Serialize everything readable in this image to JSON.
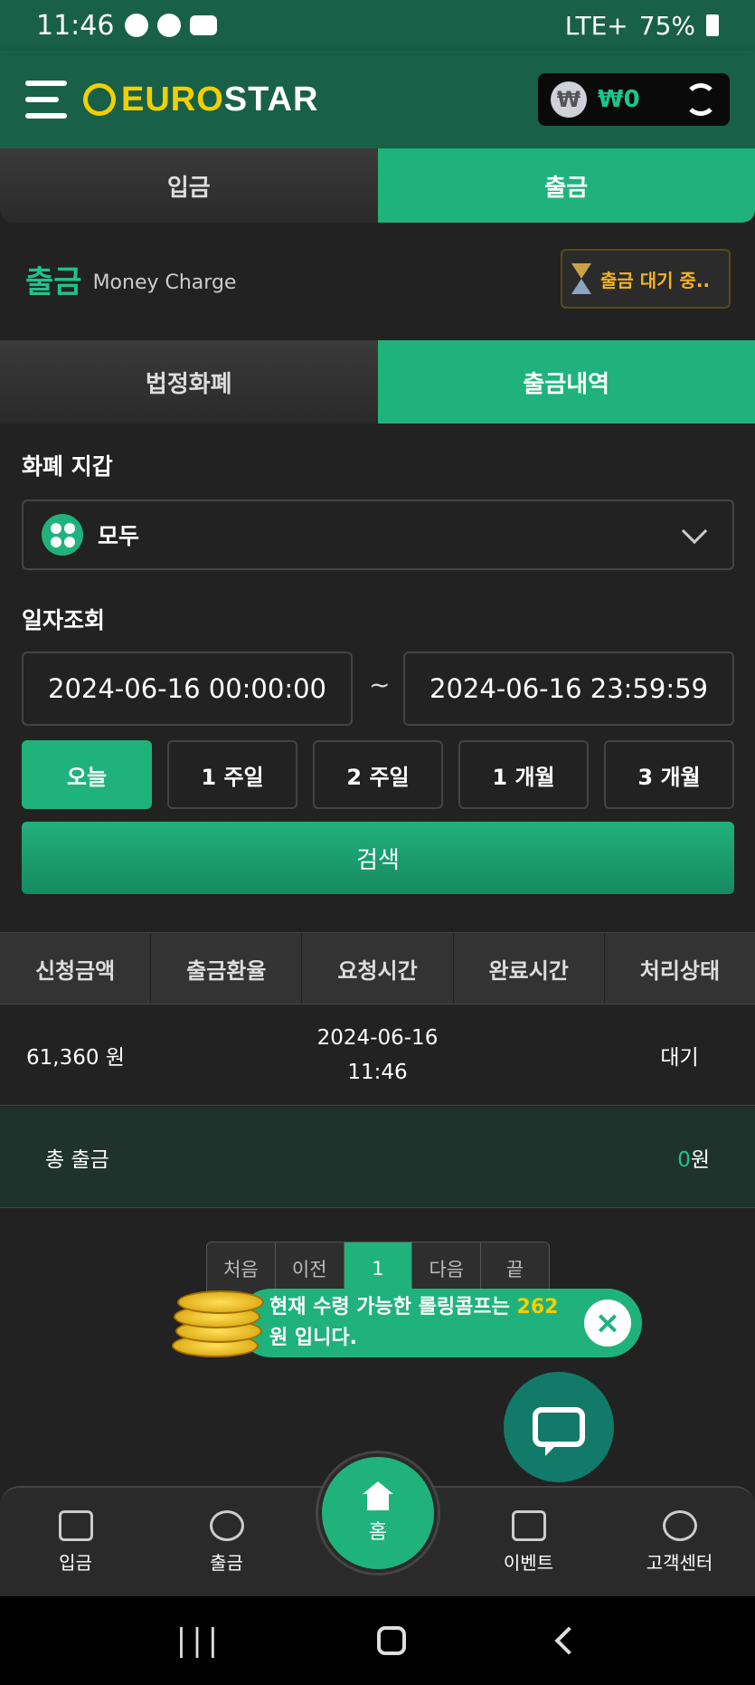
{
  "status_bar": {
    "time": "11:46",
    "battery": "75%",
    "network": "LTE+"
  },
  "header": {
    "logo_first": "EURO",
    "logo_second": "STAR",
    "currency_symbol": "₩",
    "balance": "₩0"
  },
  "top_tabs": [
    {
      "label": "입금",
      "active": false
    },
    {
      "label": "출금",
      "active": true
    }
  ],
  "title": {
    "main": "출금",
    "sub": "Money Charge",
    "pending_label": "출금 대기 중.."
  },
  "sub_tabs": [
    {
      "label": "법정화폐",
      "active": false
    },
    {
      "label": "출금내역",
      "active": true
    }
  ],
  "wallet_section": {
    "label": "화폐 지갑",
    "selected": "모두"
  },
  "date_section": {
    "label": "일자조회",
    "from": "2024-06-16 00:00:00",
    "to": "2024-06-16 23:59:59",
    "separator": "~"
  },
  "periods": [
    {
      "label": "오늘",
      "active": true
    },
    {
      "label": "1 주일"
    },
    {
      "label": "2 주일"
    },
    {
      "label": "1 개월"
    },
    {
      "label": "3 개월"
    }
  ],
  "search_label": "검색",
  "table": {
    "headers": [
      "신청금액",
      "출금환율",
      "요청시간",
      "완료시간",
      "처리상태"
    ],
    "rows": [
      {
        "amount": "61,360 원",
        "rate": "",
        "request_date": "2024-06-16",
        "request_time": "11:46",
        "done": "",
        "status": "대기"
      }
    ]
  },
  "total": {
    "label": "총 출금",
    "value": "0",
    "unit": "원"
  },
  "pager": [
    "처음",
    "이전",
    "1",
    "다음",
    "끝"
  ],
  "toast": {
    "prefix": "현재 수령 가능한 롤링콤프는 ",
    "amount": "262",
    "suffix": " 원 입니다."
  },
  "bottom_nav": [
    {
      "label": "입금",
      "icon": "deposit-icon"
    },
    {
      "label": "출금",
      "icon": "withdraw-icon"
    },
    {
      "label": "홈",
      "icon": "home-icon"
    },
    {
      "label": "이벤트",
      "icon": "megaphone-icon"
    },
    {
      "label": "고객센터",
      "icon": "support-24-icon"
    }
  ],
  "colors": {
    "brand_green": "#1fb27d",
    "header_green": "#186047",
    "accent_yellow": "#f2d000",
    "pending_orange": "#f2b321"
  }
}
